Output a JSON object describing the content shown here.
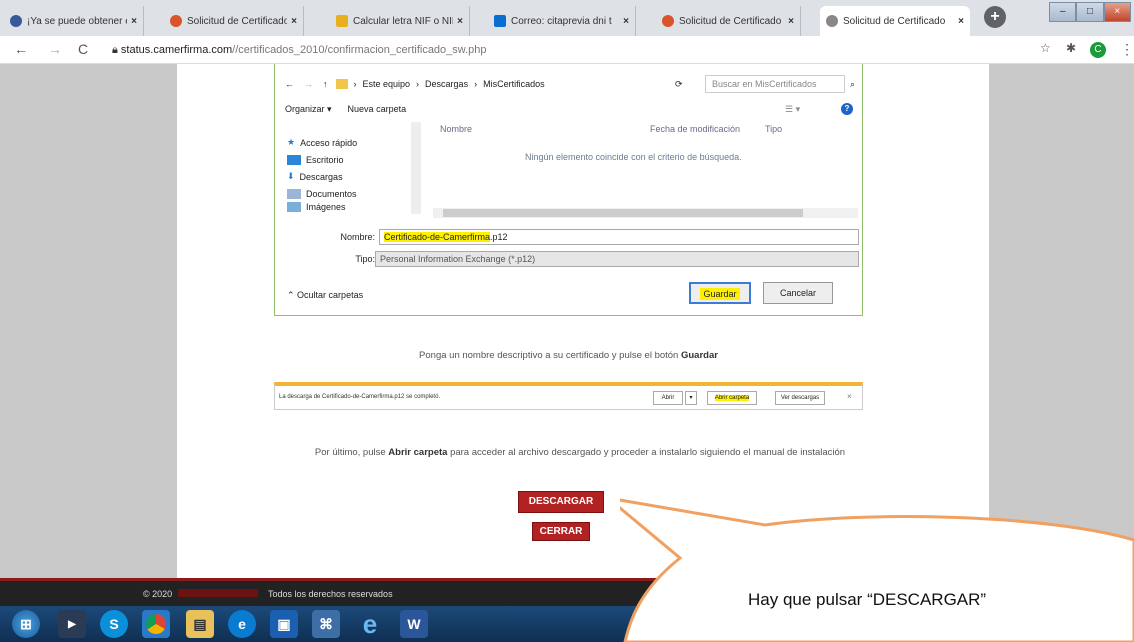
{
  "browser": {
    "tabs": [
      {
        "label": "¡Ya se puede obtener e",
        "icon": "feather-icon",
        "color": "#3b5998"
      },
      {
        "label": "Solicitud de Certificado",
        "icon": "camerfirma-icon",
        "color": "#d9542b"
      },
      {
        "label": "Calcular letra NIF o NIE",
        "icon": "calculator-icon",
        "color": "#e8b020"
      },
      {
        "label": "Correo: citaprevia dni t",
        "icon": "outlook-icon",
        "color": "#0a6ed1"
      },
      {
        "label": "Solicitud de Certificado",
        "icon": "camerfirma-icon",
        "color": "#d9542b"
      },
      {
        "label": "Solicitud de Certificado",
        "icon": "globe-icon",
        "color": "#666666"
      }
    ],
    "new_tab": "+",
    "url_host": "status.camerfirma.com",
    "url_path": "//certificados_2010/confirmacion_certificado_sw.php",
    "avatar_letter": "C"
  },
  "dialog": {
    "path": [
      "Este equipo",
      "Descargas",
      "MisCertificados"
    ],
    "search_placeholder": "Buscar en MisCertificados",
    "organizar": "Organizar ▾",
    "nueva_carpeta": "Nueva carpeta",
    "nav_items": [
      "Acceso rápido",
      "Escritorio",
      "Descargas",
      "Documentos",
      "Imágenes"
    ],
    "col_nombre": "Nombre",
    "col_fecha": "Fecha de modificación",
    "col_tipo": "Tipo",
    "empty_message": "Ningún elemento coincide con el criterio de búsqueda.",
    "nombre_label": "Nombre:",
    "filename_highlight": "Certificado-de-Camerfirma",
    "filename_ext": ".p12",
    "tipo_label": "Tipo:",
    "tipo_value": "Personal Information Exchange (*.p12)",
    "ocultar": "Ocultar carpetas",
    "guardar": "Guardar",
    "cancelar": "Cancelar"
  },
  "instructions": {
    "line1_pre": "Ponga un nombre descriptivo a su certificado y pulse el botón ",
    "line1_bold": "Guardar",
    "line2_pre": "Por último, pulse ",
    "line2_bold": "Abrir carpeta",
    "line2_post": " para acceder al archivo descargado y proceder a instalarlo siguiendo el manual de instalación"
  },
  "download_bar": {
    "text": "La descarga de Certificado-de-Camerfirma.p12 se completó.",
    "abrir": "Abrir",
    "abrir_carpeta": "Abrir carpeta",
    "ver_descargas": "Ver descargas",
    "close": "×"
  },
  "buttons": {
    "descargar": "DESCARGAR",
    "cerrar": "CERRAR"
  },
  "footer": {
    "copyright": "© 2020",
    "rights": "Todos los derechos reservados"
  },
  "callout": {
    "text": "Hay que pulsar “DESCARGAR”",
    "fill": "#ffffff",
    "stroke": "#f0a060"
  },
  "taskbar": {
    "items": [
      "start-orb-icon",
      "media-player-icon",
      "skype-icon",
      "chrome-icon",
      "file-explorer-icon",
      "edge-icon",
      "store-icon",
      "network-icon",
      "ie-icon",
      "word-icon"
    ]
  }
}
